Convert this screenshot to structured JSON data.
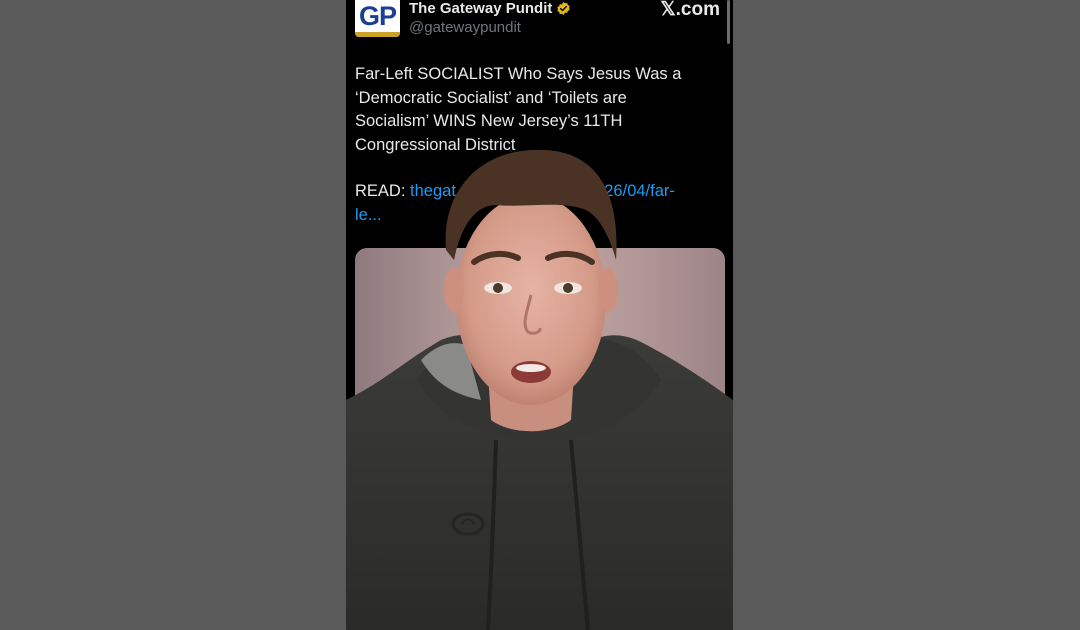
{
  "tweet": {
    "account": {
      "avatar_text": "GP",
      "name": "The Gateway Pundit",
      "handle": "@gatewaypundit",
      "verified_icon": "verified-badge-icon",
      "verified_color": "#e2b719"
    },
    "site_brand": "𝕏.com",
    "text_lines": [
      "Far-Left SOCIALIST Who Says Jesus Was a",
      "‘Democratic Socialist’ and ‘Toilets are",
      "Socialism’ WINS New Jersey’s 11TH",
      "Congressional District"
    ],
    "read_label": "READ:",
    "read_link_start": "thegat",
    "read_link_end": "2026/04/far-",
    "read_link_line2": "le..."
  },
  "colors": {
    "background": "#5a5a5a",
    "tweet_background": "#000000",
    "link": "#1d9bf0",
    "text": "#e7e9ea",
    "handle": "#71767b"
  },
  "overlay": {
    "person_icon": "person-presenter-illustration",
    "hoodie_logo_icon": "champion-c-logo-icon"
  }
}
